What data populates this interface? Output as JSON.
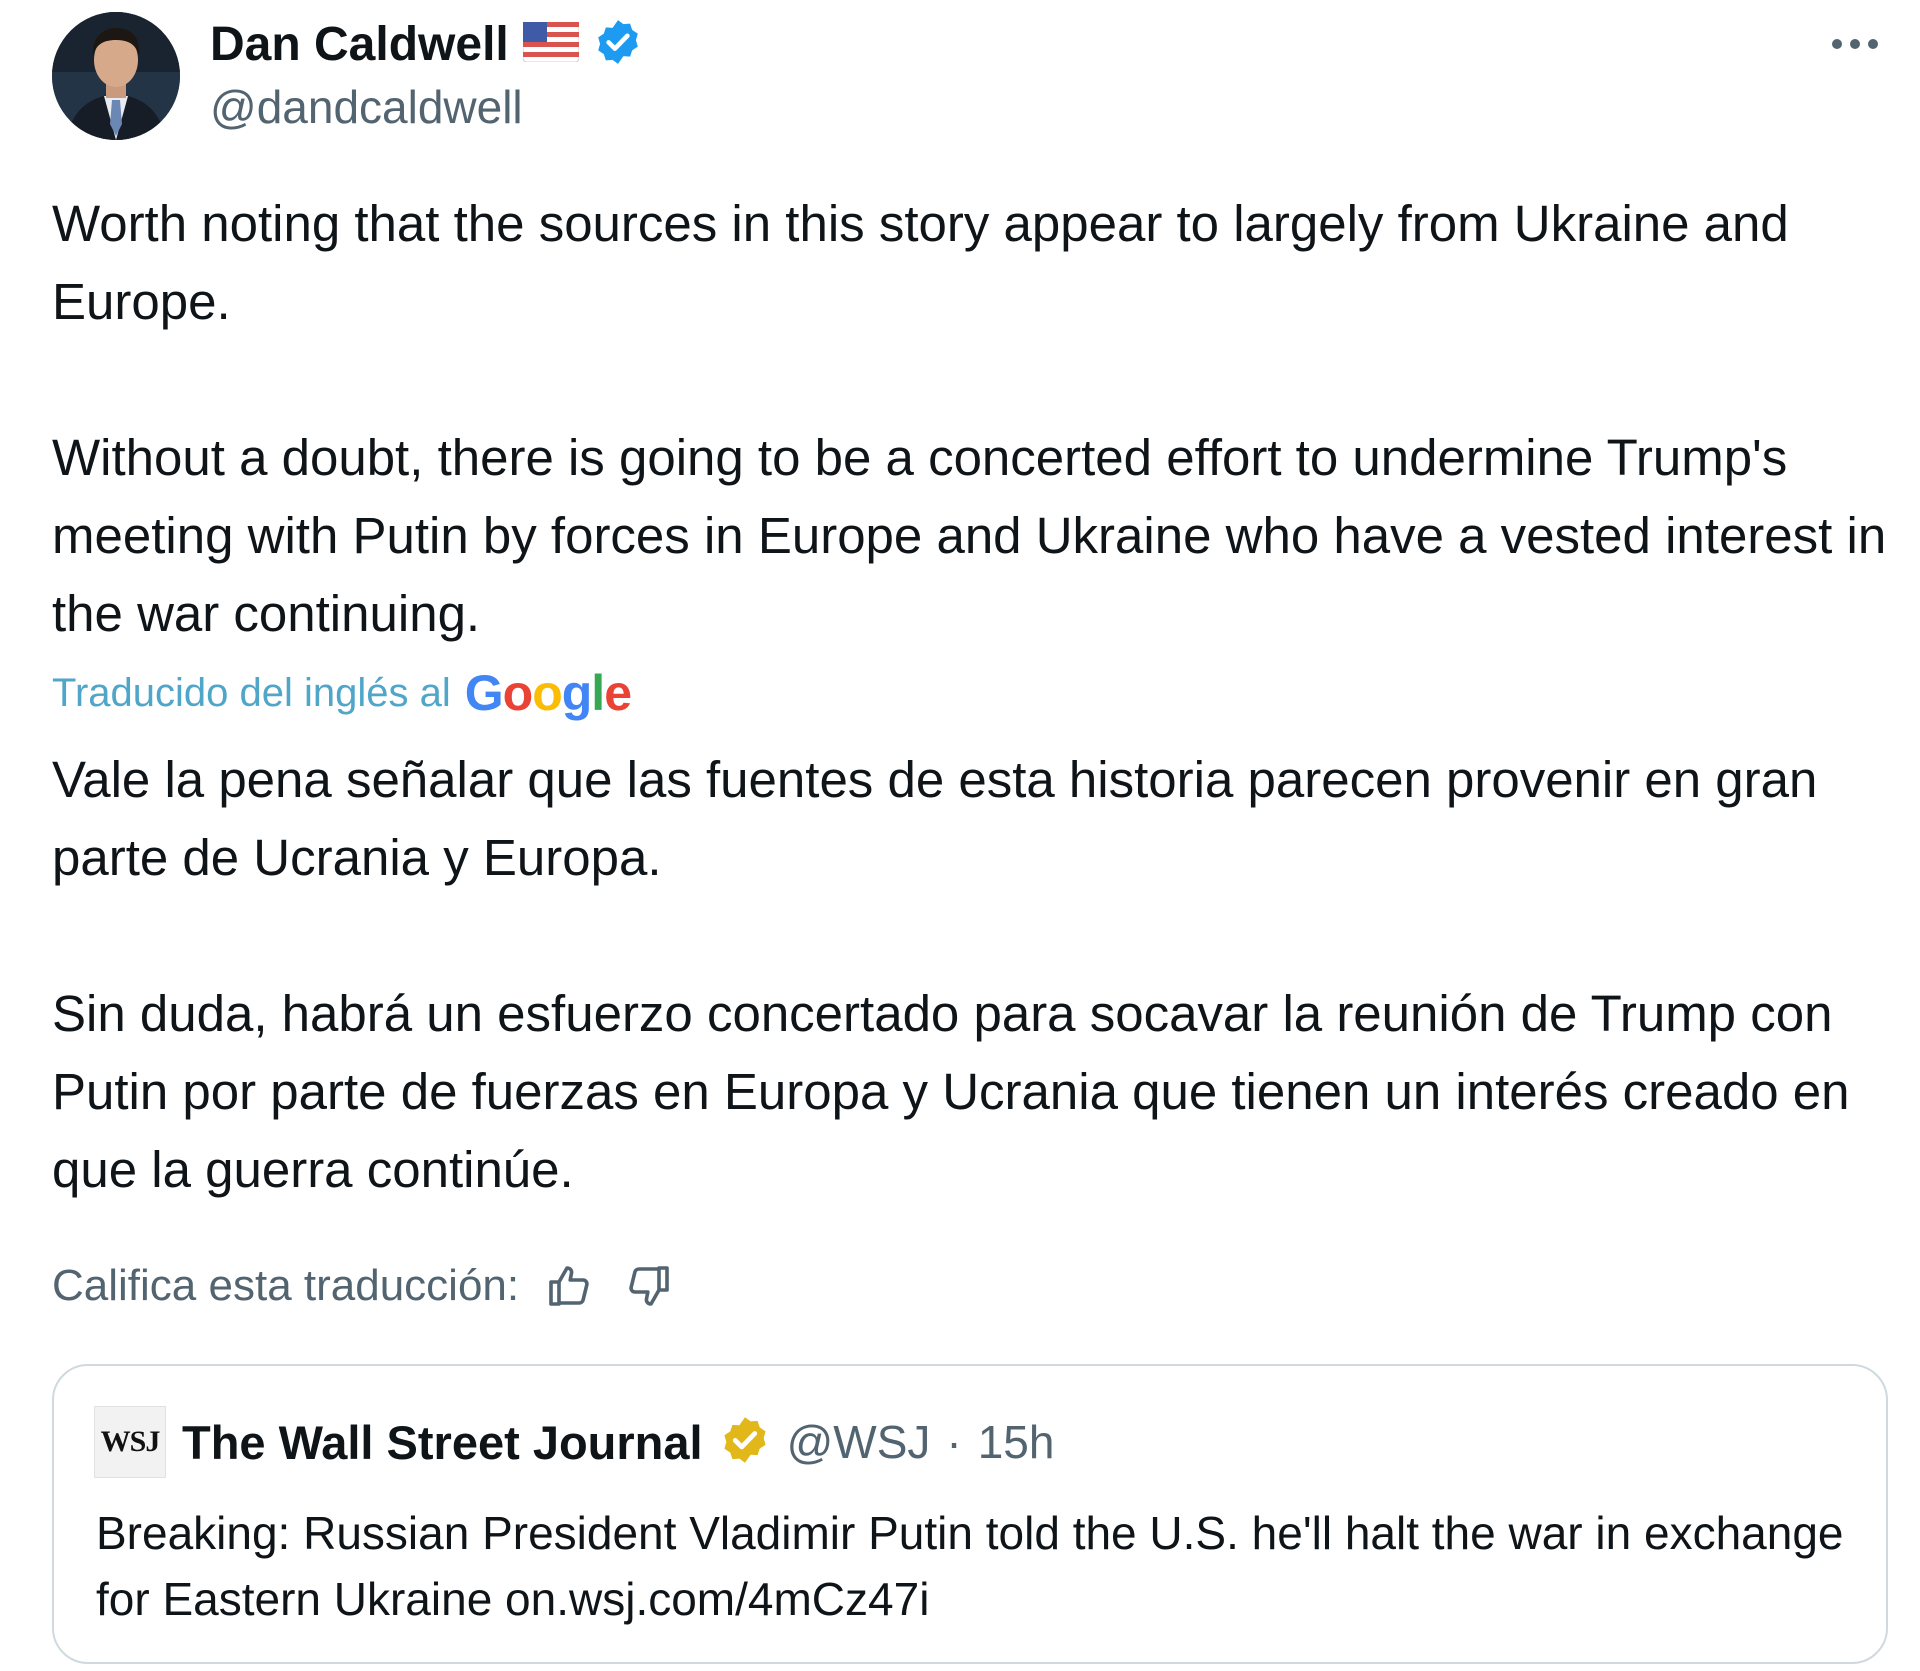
{
  "author": {
    "name": "Dan Caldwell",
    "handle": "@dandcaldwell",
    "flag_icon": "us-flag-icon",
    "verified_color": "#1d9bf0"
  },
  "menu": {
    "more_icon": "more-horizontal-icon"
  },
  "tweet": {
    "original_paragraphs": [
      "Worth noting that the sources in this story appear to largely from Ukraine and Europe.",
      "Without a doubt, there is going to be a concerted effort to undermine Trump's meeting with Putin by forces in Europe and Ukraine who have a vested interest in the war continuing."
    ],
    "translated_label": "Traducido del inglés al",
    "translator_logo_letters": [
      "G",
      "o",
      "o",
      "g",
      "l",
      "e"
    ],
    "translator_logo_colors": [
      "#4285f4",
      "#ea4335",
      "#fbbc05",
      "#4285f4",
      "#34a853",
      "#ea4335"
    ],
    "translated_paragraphs": [
      "Vale la pena señalar que las fuentes de esta historia parecen provenir en gran parte de Ucrania y Europa.",
      "Sin duda, habrá un esfuerzo concertado para socavar la reunión de Trump con Putin por parte de fuerzas en Europa y Ucrania que tienen un interés creado en que la guerra continúe."
    ],
    "rate_label": "Califica esta traducción:"
  },
  "quote": {
    "logo_text": "WSJ",
    "name": "The Wall Street Journal",
    "handle": "@WSJ",
    "separator": "·",
    "time": "15h",
    "verified_color": "#e2b719",
    "text": "Breaking: Russian President Vladimir Putin told the U.S. he'll halt the war in exchange for Eastern Ukraine on.wsj.com/4mCz47i"
  }
}
